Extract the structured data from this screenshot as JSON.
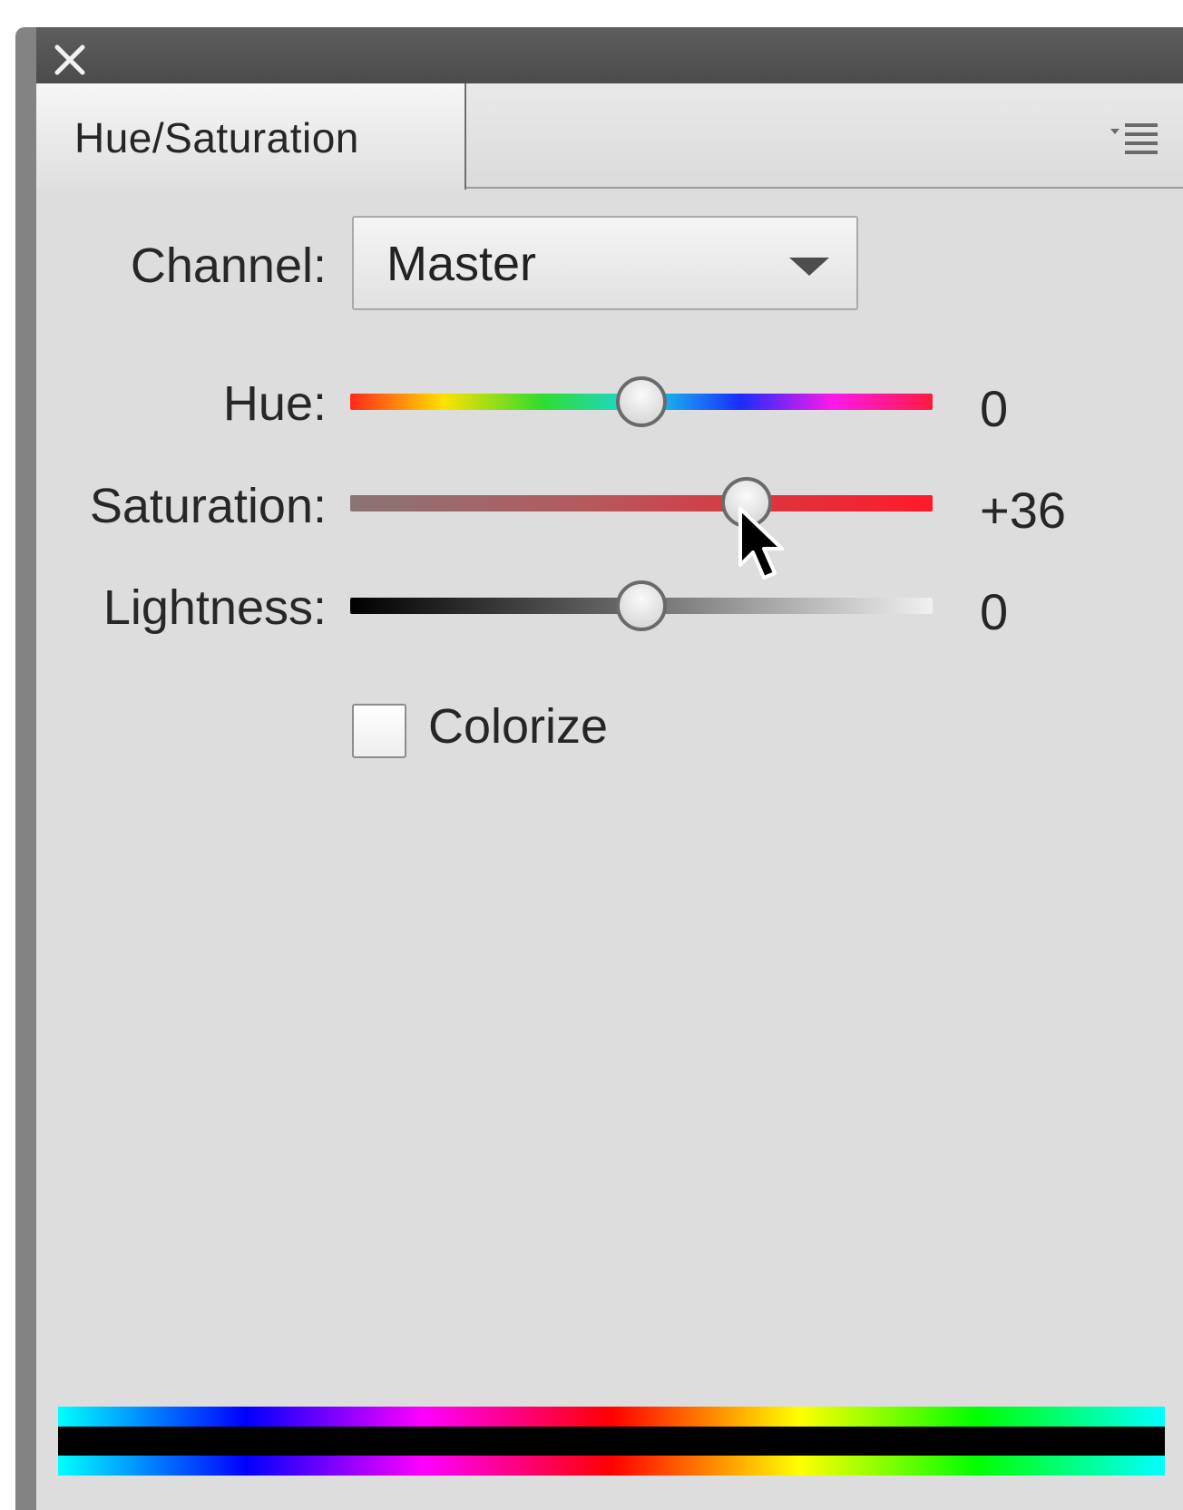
{
  "panel": {
    "tab_label": "Hue/Saturation"
  },
  "channel": {
    "label": "Channel:",
    "selected": "Master"
  },
  "sliders": [
    {
      "label": "Hue:",
      "value_text": "0",
      "value": 0,
      "min": -180,
      "max": 180
    },
    {
      "label": "Saturation:",
      "value_text": "+36",
      "value": 36,
      "min": -100,
      "max": 100
    },
    {
      "label": "Lightness:",
      "value_text": "0",
      "value": 0,
      "min": -100,
      "max": 100
    }
  ],
  "colorize": {
    "label": "Colorize",
    "checked": false
  },
  "icons": {
    "close": "close-icon",
    "panel_menu": "panel-menu-icon",
    "dropdown": "chevron-down-icon",
    "cursor": "mouse-pointer-icon"
  },
  "colors": {
    "panel_bg": "#dddddd",
    "titlebar": "#545454",
    "saturation_track_end": "#ff1a2a"
  }
}
